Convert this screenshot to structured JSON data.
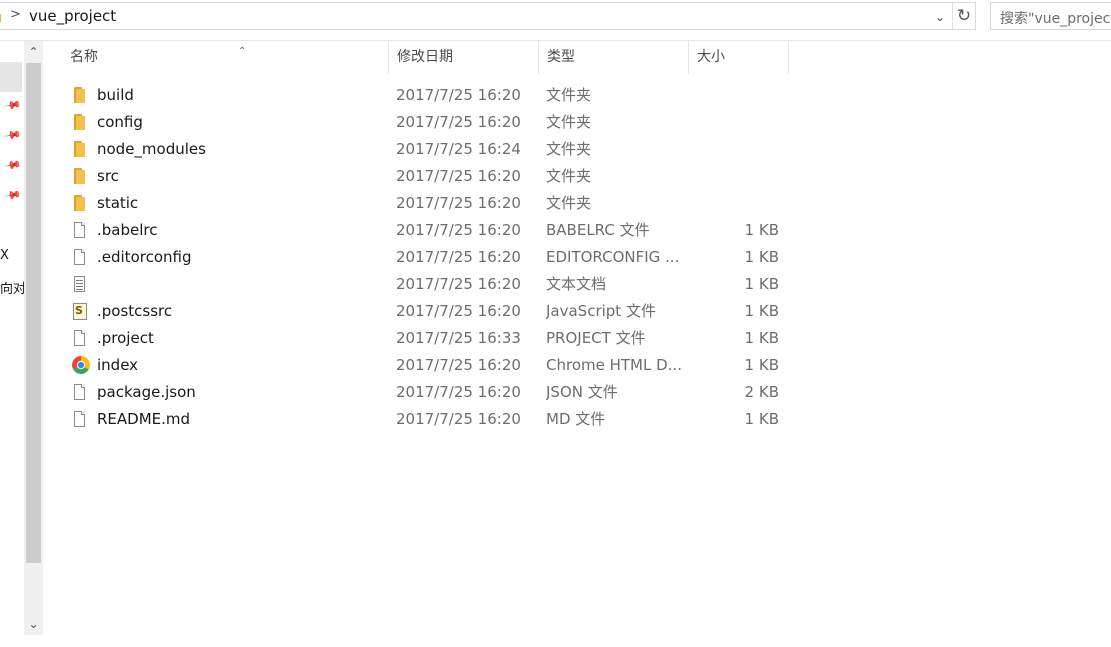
{
  "address": {
    "path": "vue_project",
    "chevron": ">"
  },
  "search": {
    "placeholder": "搜索\"vue_project\""
  },
  "nav": {
    "fragments": [
      "X",
      "向对"
    ]
  },
  "columns": {
    "name": "名称",
    "date": "修改日期",
    "type": "类型",
    "size": "大小"
  },
  "files": [
    {
      "name": "build",
      "date": "2017/7/25 16:20",
      "type": "文件夹",
      "size": "",
      "icon": "folder-icon"
    },
    {
      "name": "config",
      "date": "2017/7/25 16:20",
      "type": "文件夹",
      "size": "",
      "icon": "folder-icon"
    },
    {
      "name": "node_modules",
      "date": "2017/7/25 16:24",
      "type": "文件夹",
      "size": "",
      "icon": "folder-icon"
    },
    {
      "name": "src",
      "date": "2017/7/25 16:20",
      "type": "文件夹",
      "size": "",
      "icon": "folder-icon"
    },
    {
      "name": "static",
      "date": "2017/7/25 16:20",
      "type": "文件夹",
      "size": "",
      "icon": "folder-icon"
    },
    {
      "name": ".babelrc",
      "date": "2017/7/25 16:20",
      "type": "BABELRC 文件",
      "size": "1 KB",
      "icon": "file-icon"
    },
    {
      "name": ".editorconfig",
      "date": "2017/7/25 16:20",
      "type": "EDITORCONFIG ...",
      "size": "1 KB",
      "icon": "file-icon"
    },
    {
      "name": "",
      "date": "2017/7/25 16:20",
      "type": "文本文档",
      "size": "1 KB",
      "icon": "text-document-icon"
    },
    {
      "name": ".postcssrc",
      "date": "2017/7/25 16:20",
      "type": "JavaScript 文件",
      "size": "1 KB",
      "icon": "javascript-file-icon"
    },
    {
      "name": ".project",
      "date": "2017/7/25 16:33",
      "type": "PROJECT 文件",
      "size": "1 KB",
      "icon": "file-icon"
    },
    {
      "name": "index",
      "date": "2017/7/25 16:20",
      "type": "Chrome HTML D...",
      "size": "1 KB",
      "icon": "chrome-icon"
    },
    {
      "name": "package.json",
      "date": "2017/7/25 16:20",
      "type": "JSON 文件",
      "size": "2 KB",
      "icon": "file-icon"
    },
    {
      "name": "README.md",
      "date": "2017/7/25 16:20",
      "type": "MD 文件",
      "size": "1 KB",
      "icon": "file-icon"
    }
  ],
  "colors": {
    "folder": "#f3c14a",
    "selection": "#e5e5e5",
    "border": "#d9d9d9"
  }
}
